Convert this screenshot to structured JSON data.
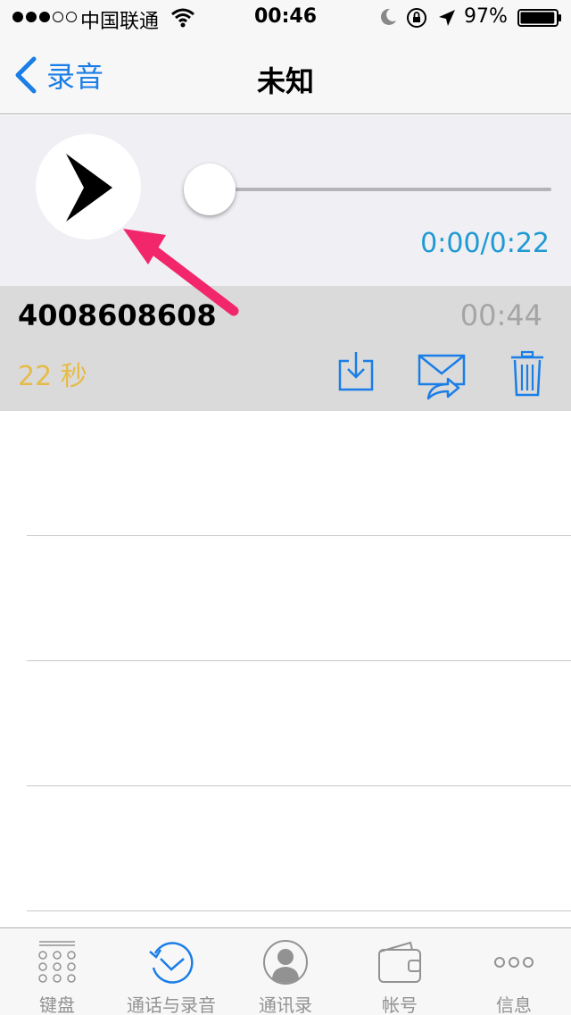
{
  "status_bar": {
    "signal_dots": [
      true,
      true,
      true,
      false,
      false
    ],
    "carrier": "中国联通",
    "time": "00:46",
    "battery_percent": "97%",
    "battery_level": 0.97,
    "icons": [
      "wifi-icon",
      "moon-icon",
      "rotation-lock-icon",
      "location-arrow-icon",
      "battery-icon"
    ]
  },
  "nav": {
    "back_label": "录音",
    "title": "未知"
  },
  "player": {
    "time_readout": "0:00/0:22",
    "progress": 0
  },
  "recording": {
    "phone_number": "4008608608",
    "time": "00:44",
    "duration": "22 秒",
    "actions": [
      "download-icon",
      "share-mail-icon",
      "trash-icon"
    ]
  },
  "tab_bar": {
    "active_index": 1,
    "tabs": [
      {
        "label": "键盘",
        "icon": "keypad-icon"
      },
      {
        "label": "通话与录音",
        "icon": "history-clock-icon"
      },
      {
        "label": "通讯录",
        "icon": "contacts-icon"
      },
      {
        "label": "帐号",
        "icon": "wallet-icon"
      },
      {
        "label": "信息",
        "icon": "more-dots-icon"
      }
    ]
  },
  "colors": {
    "accent": "#1a7ee6",
    "time_readout": "#1e9ad3",
    "duration": "#e5bb4a",
    "annotation_arrow": "#f2276b",
    "row_background": "#dadada",
    "player_background": "#efeff4"
  }
}
